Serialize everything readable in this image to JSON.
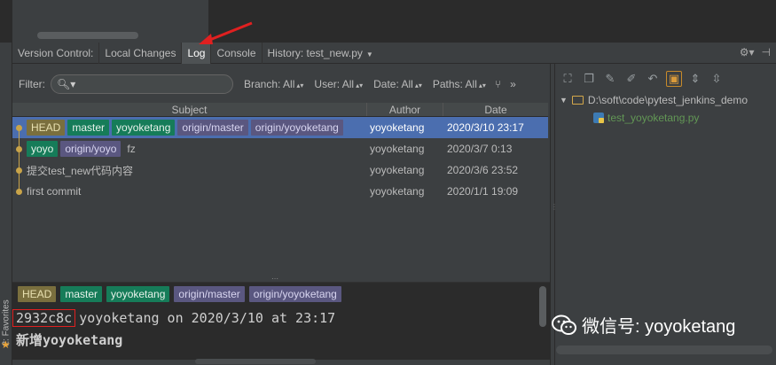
{
  "tabbar": {
    "title": "Version Control:",
    "tabs": [
      {
        "label": "Local Changes",
        "active": false
      },
      {
        "label": "Log",
        "active": true
      },
      {
        "label": "Console",
        "active": false
      },
      {
        "label": "History: test_new.py",
        "active": false
      }
    ],
    "right_icons": [
      "gear-icon",
      "minimize-icon"
    ]
  },
  "filter": {
    "label": "Filter:",
    "search_value": "",
    "dropdowns": [
      {
        "label": "Branch: All"
      },
      {
        "label": "User: All"
      },
      {
        "label": "Date: All"
      },
      {
        "label": "Paths: All"
      }
    ]
  },
  "log": {
    "columns": [
      "Subject",
      "Author",
      "Date"
    ],
    "rows": [
      {
        "tags": [
          {
            "text": "HEAD",
            "kind": "head"
          },
          {
            "text": "master",
            "kind": "local"
          },
          {
            "text": "yoyoketang",
            "kind": "local"
          },
          {
            "text": "origin/master",
            "kind": "remote"
          },
          {
            "text": "origin/yoyoketang",
            "kind": "remote"
          }
        ],
        "subject": "",
        "author": "yoyoketang",
        "date": "2020/3/10 23:17",
        "selected": true
      },
      {
        "tags": [
          {
            "text": "yoyo",
            "kind": "local"
          },
          {
            "text": "origin/yoyo",
            "kind": "remote"
          }
        ],
        "subject": "fz",
        "author": "yoyoketang",
        "date": "2020/3/7 0:13",
        "selected": false
      },
      {
        "tags": [],
        "subject": "提交test_new代码内容",
        "author": "yoyoketang",
        "date": "2020/3/6 23:52",
        "selected": false
      },
      {
        "tags": [],
        "subject": "first commit",
        "author": "yoyoketang",
        "date": "2020/1/1 19:09",
        "selected": false
      }
    ]
  },
  "details": {
    "tags": [
      {
        "text": "HEAD",
        "kind": "head"
      },
      {
        "text": "master",
        "kind": "local"
      },
      {
        "text": "yoyoketang",
        "kind": "local"
      },
      {
        "text": "origin/master",
        "kind": "remote"
      },
      {
        "text": "origin/yoyoketang",
        "kind": "remote"
      }
    ],
    "hash": "2932c8c",
    "info": "yoyoketang on 2020/3/10 at 23:17",
    "message": "新增yoyoketang"
  },
  "changes": {
    "root": "D:\\soft\\code\\pytest_jenkins_demo",
    "file": "test_yoyoketang.py"
  },
  "sidebar": {
    "favorites_label": "2: Favorites"
  },
  "watermark": {
    "text": "微信号: yoyoketang"
  },
  "colors": {
    "accent_selected": "#4b6eaf",
    "tag_head": "#7a6f3e",
    "tag_local": "#167c59",
    "tag_remote": "#5a5780",
    "annotation_red": "#e02020",
    "file_added_green": "#629755"
  }
}
